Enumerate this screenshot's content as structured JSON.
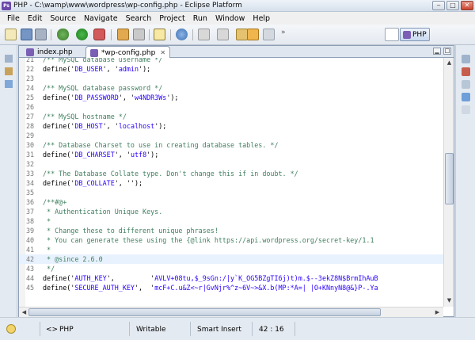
{
  "window": {
    "title": "PHP - C:\\wamp\\www\\wordpress\\wp-config.php - Eclipse Platform"
  },
  "menu": [
    "File",
    "Edit",
    "Source",
    "Navigate",
    "Search",
    "Project",
    "Run",
    "Window",
    "Help"
  ],
  "toolbar": {
    "perspective_label": "PHP"
  },
  "tabs": [
    {
      "label": "index.php",
      "active": false
    },
    {
      "label": "*wp-config.php",
      "active": true
    }
  ],
  "code_lines": [
    {
      "num": "21",
      "text": "/** MySQL database username */",
      "kind": "comment"
    },
    {
      "num": "22",
      "pre": "define('",
      "str": "DB_USER",
      "mid": "', '",
      "str2": "admin",
      "post": "');",
      "kind": "define"
    },
    {
      "num": "23",
      "text": "",
      "kind": "plain"
    },
    {
      "num": "24",
      "text": "/** MySQL database password */",
      "kind": "comment"
    },
    {
      "num": "25",
      "pre": "define('",
      "str": "DB_PASSWORD",
      "mid": "', '",
      "str2": "w4NDR3Ws",
      "post": "');",
      "kind": "define"
    },
    {
      "num": "26",
      "text": "",
      "kind": "plain"
    },
    {
      "num": "27",
      "text": "/** MySQL hostname */",
      "kind": "comment"
    },
    {
      "num": "28",
      "pre": "define('",
      "str": "DB_HOST",
      "mid": "', '",
      "str2": "localhost",
      "post": "');",
      "kind": "define"
    },
    {
      "num": "29",
      "text": "",
      "kind": "plain"
    },
    {
      "num": "30",
      "text": "/** Database Charset to use in creating database tables. */",
      "kind": "comment"
    },
    {
      "num": "31",
      "pre": "define('",
      "str": "DB_CHARSET",
      "mid": "', '",
      "str2": "utf8",
      "post": "');",
      "kind": "define"
    },
    {
      "num": "32",
      "text": "",
      "kind": "plain"
    },
    {
      "num": "33",
      "text": "/** The Database Collate type. Don't change this if in doubt. */",
      "kind": "comment"
    },
    {
      "num": "34",
      "pre": "define('",
      "str": "DB_COLLATE",
      "mid": "', '",
      "str2": "",
      "post": "');",
      "kind": "define"
    },
    {
      "num": "35",
      "text": "",
      "kind": "plain"
    },
    {
      "num": "36",
      "text": "/**#@+",
      "kind": "comment"
    },
    {
      "num": "37",
      "text": " * Authentication Unique Keys.",
      "kind": "comment"
    },
    {
      "num": "38",
      "text": " *",
      "kind": "comment"
    },
    {
      "num": "39",
      "text": " * Change these to different unique phrases!",
      "kind": "comment"
    },
    {
      "num": "40",
      "text": " * You can generate these using the {@link https://api.wordpress.org/secret-key/1.1",
      "kind": "comment"
    },
    {
      "num": "41",
      "text": " *",
      "kind": "comment"
    },
    {
      "num": "42",
      "text": " * @since 2.6.0",
      "kind": "comment"
    },
    {
      "num": "43",
      "text": " */",
      "kind": "comment"
    },
    {
      "num": "44",
      "pre": "define('",
      "str": "AUTH_KEY",
      "mid": "',         '",
      "str2": "AVLV+08tu,$_9sGn:/|y`K_OG5BZgTI6j)t)m.$--3ekZ8N$BrmIhAuB",
      "post": "",
      "kind": "define"
    },
    {
      "num": "45",
      "pre": "define('",
      "str": "SECURE_AUTH_KEY",
      "mid": "',  '",
      "str2": "mcF+C.u&Z<~r|GvNjr%^z~6V~>&X.b(MP:*A=| |O+KNnyN8@&}P-.Ya",
      "post": "",
      "kind": "define"
    }
  ],
  "status": {
    "language": "PHP",
    "writable": "Writable",
    "insert_mode": "Smart Insert",
    "position": "42 : 16"
  }
}
